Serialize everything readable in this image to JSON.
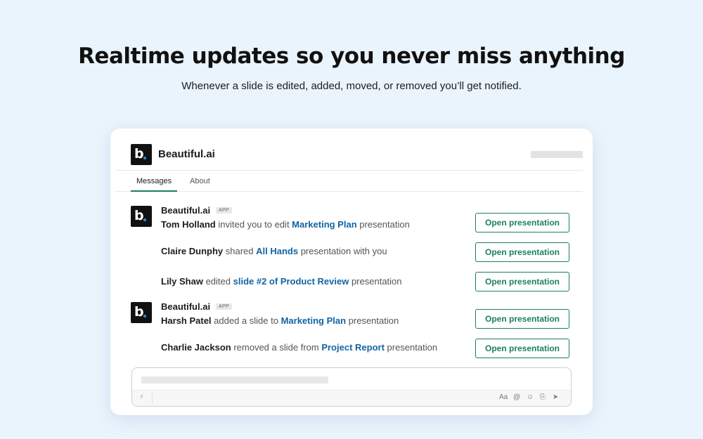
{
  "hero": {
    "title": "Realtime updates so you never miss anything",
    "subtitle": "Whenever a slide is edited, added, moved, or removed you’ll get notified."
  },
  "app": {
    "name": "Beautiful.ai",
    "logo_letter": "b",
    "badge": "APP",
    "accent": "#1a7f64",
    "link_color": "#1264a3",
    "logo_dot_color": "#2f8bf0"
  },
  "tabs": [
    {
      "label": "Messages",
      "active": true
    },
    {
      "label": "About",
      "active": false
    }
  ],
  "messages": [
    {
      "who": "Tom Holland",
      "pre": " invited you to edit ",
      "link": "Marketing Plan",
      "post": " presentation",
      "button": "Open presentation"
    },
    {
      "who": "Claire Dunphy",
      "pre": " shared ",
      "link": "All Hands",
      "post": " presentation with you",
      "button": "Open presentation"
    },
    {
      "who": "Lily Shaw",
      "pre": " edited ",
      "link": "slide #2 of Product Review",
      "post": " presentation",
      "button": "Open presentation"
    },
    {
      "who": "Harsh Patel",
      "pre": " added a slide to ",
      "link": "Marketing Plan",
      "post": " presentation",
      "button": "Open presentation"
    },
    {
      "who": "Charlie Jackson",
      "pre": " removed a slide from ",
      "link": "Project Report",
      "post": " presentation",
      "button": "Open presentation"
    }
  ],
  "composer": {
    "icons": [
      "lightning-icon",
      "format-text-icon",
      "mention-icon",
      "emoji-icon",
      "attachment-icon",
      "send-icon"
    ],
    "format_label": "Aa",
    "mention_label": "@"
  }
}
